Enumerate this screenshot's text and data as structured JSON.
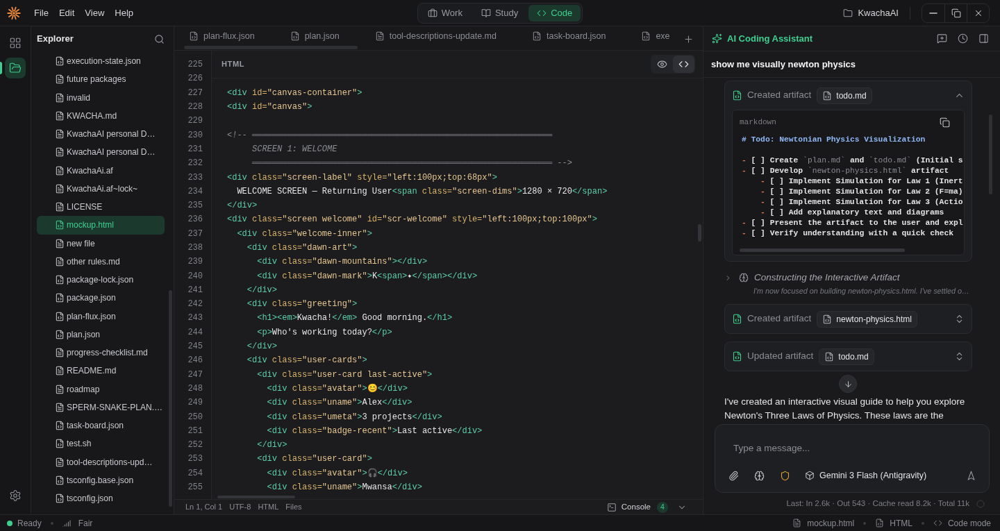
{
  "top_bar": {
    "menu": [
      "File",
      "Edit",
      "View",
      "Help"
    ],
    "modes": [
      {
        "label": "Work",
        "selected": false
      },
      {
        "label": "Study",
        "selected": false
      },
      {
        "label": "Code",
        "selected": true
      }
    ],
    "workspace": "KwachaAI"
  },
  "activity_bar": [
    {
      "selected": false
    },
    {
      "selected": true
    }
  ],
  "explorer": {
    "title": "Explorer",
    "files": [
      {
        "name": "execution-state.json",
        "kind": "code",
        "selected": false
      },
      {
        "name": "future packages",
        "kind": "text",
        "selected": false
      },
      {
        "name": "invalid",
        "kind": "text",
        "selected": false
      },
      {
        "name": "KWACHA.md",
        "kind": "text",
        "selected": false
      },
      {
        "name": "KwachaAI personal D…",
        "kind": "text",
        "selected": false
      },
      {
        "name": "KwachaAI personal D…",
        "kind": "text",
        "selected": false
      },
      {
        "name": "KwachaAi.af",
        "kind": "text",
        "selected": false
      },
      {
        "name": "KwachaAi.af~lock~",
        "kind": "text",
        "selected": false
      },
      {
        "name": "LICENSE",
        "kind": "text",
        "selected": false
      },
      {
        "name": "mockup.html",
        "kind": "code",
        "selected": true
      },
      {
        "name": "new file",
        "kind": "text",
        "selected": false
      },
      {
        "name": "other rules.md",
        "kind": "text",
        "selected": false
      },
      {
        "name": "package-lock.json",
        "kind": "code",
        "selected": false
      },
      {
        "name": "package.json",
        "kind": "code",
        "selected": false
      },
      {
        "name": "plan-flux.json",
        "kind": "code",
        "selected": false
      },
      {
        "name": "plan.json",
        "kind": "code",
        "selected": false
      },
      {
        "name": "progress-checklist.md",
        "kind": "text",
        "selected": false
      },
      {
        "name": "README.md",
        "kind": "text",
        "selected": false
      },
      {
        "name": "roadmap",
        "kind": "text",
        "selected": false
      },
      {
        "name": "SPERM-SNAKE-PLAN.…",
        "kind": "text",
        "selected": false
      },
      {
        "name": "task-board.json",
        "kind": "code",
        "selected": false
      },
      {
        "name": "test.sh",
        "kind": "code",
        "selected": false
      },
      {
        "name": "tool-descriptions-upd…",
        "kind": "text",
        "selected": false
      },
      {
        "name": "tsconfig.base.json",
        "kind": "code",
        "selected": false
      },
      {
        "name": "tsconfig.json",
        "kind": "code",
        "selected": false
      }
    ]
  },
  "editor": {
    "tabs": [
      {
        "label": "plan-flux.json",
        "kind": "code",
        "selected": false
      },
      {
        "label": "plan.json",
        "kind": "code",
        "selected": false
      },
      {
        "label": "tool-descriptions-update.md",
        "kind": "text",
        "selected": false
      },
      {
        "label": "task-board.json",
        "kind": "code",
        "selected": false
      },
      {
        "label": "exe",
        "kind": "code",
        "selected": false
      }
    ],
    "language": "HTML",
    "view_toggle": [
      {
        "selected": false
      },
      {
        "selected": true
      }
    ],
    "lines": [
      {
        "number": "225"
      },
      {
        "number": "226"
      },
      {
        "number": "227",
        "kind": "code",
        "code": "<div id=\"canvas-container\">"
      },
      {
        "number": "228",
        "kind": "code",
        "code": "<div id=\"canvas\">"
      },
      {
        "number": "229"
      },
      {
        "number": "230",
        "kind": "comment",
        "code": "<!-- ════════════════════════════════════════════════════════════"
      },
      {
        "number": "231",
        "kind": "comment",
        "code": "     SCREEN 1: WELCOME"
      },
      {
        "number": "232",
        "kind": "comment",
        "code": "     ════════════════════════════════════════════════════════════ -->"
      },
      {
        "number": "233",
        "kind": "code",
        "code": "<div class=\"screen-label\" style=\"left:100px;top:68px\">"
      },
      {
        "number": "234",
        "kind": "code",
        "code": "  WELCOME SCREEN — Returning User<span class=\"screen-dims\">1280 × 720</span>"
      },
      {
        "number": "235",
        "kind": "code",
        "code": "</div>"
      },
      {
        "number": "236",
        "kind": "code",
        "code": "<div class=\"screen welcome\" id=\"scr-welcome\" style=\"left:100px;top:100px\">"
      },
      {
        "number": "237",
        "kind": "code",
        "code": "  <div class=\"welcome-inner\">"
      },
      {
        "number": "238",
        "kind": "code",
        "code": "    <div class=\"dawn-art\">"
      },
      {
        "number": "239",
        "kind": "code",
        "code": "      <div class=\"dawn-mountains\"></div>"
      },
      {
        "number": "240",
        "kind": "code",
        "code": "      <div class=\"dawn-mark\">K<span>✦</span></div>"
      },
      {
        "number": "241",
        "kind": "code",
        "code": "    </div>"
      },
      {
        "number": "242",
        "kind": "code",
        "code": "    <div class=\"greeting\">"
      },
      {
        "number": "243",
        "kind": "code",
        "code": "      <h1><em>Kwacha!</em> Good morning.</h1>"
      },
      {
        "number": "244",
        "kind": "code",
        "code": "      <p>Who's working today?</p>"
      },
      {
        "number": "245",
        "kind": "code",
        "code": "    </div>"
      },
      {
        "number": "246",
        "kind": "code",
        "code": "    <div class=\"user-cards\">"
      },
      {
        "number": "247",
        "kind": "code",
        "code": "      <div class=\"user-card last-active\">"
      },
      {
        "number": "248",
        "kind": "code",
        "code": "        <div class=\"avatar\">😊</div>"
      },
      {
        "number": "249",
        "kind": "code",
        "code": "        <div class=\"uname\">Alex</div>"
      },
      {
        "number": "250",
        "kind": "code",
        "code": "        <div class=\"umeta\">3 projects</div>"
      },
      {
        "number": "251",
        "kind": "code",
        "code": "        <div class=\"badge-recent\">Last active</div>"
      },
      {
        "number": "252",
        "kind": "code",
        "code": "      </div>"
      },
      {
        "number": "253",
        "kind": "code",
        "code": "      <div class=\"user-card\">"
      },
      {
        "number": "254",
        "kind": "code",
        "code": "        <div class=\"avatar\">🎧</div>"
      },
      {
        "number": "255",
        "kind": "code",
        "code": "        <div class=\"uname\">Mwansa</div>"
      }
    ],
    "status": {
      "items": [
        "Ln 1, Col 1",
        "UTF-8",
        "HTML",
        "Files"
      ],
      "console": {
        "label": "Console",
        "count": "4"
      }
    }
  },
  "assistant": {
    "title": "AI Coding Assistant",
    "prompt": "show me visually newton physics",
    "messages": [
      {
        "kind": "artifact",
        "action": "Created artifact",
        "file": "todo.md",
        "expanded": true,
        "preview": {
          "language": "markdown",
          "heading": "# Todo: Newtonian Physics Visualization",
          "items": [
            {
              "text": "- [ ] Create `plan.md` and `todo.md` (Initial s"
            },
            {
              "text": "- [ ] Develop `newton-physics.html` artifact",
              "children": [
                {
                  "text": "- [ ] Implement Simulation for Law 1 (Inert"
                },
                {
                  "text": "- [ ] Implement Simulation for Law 2 (F=ma)"
                },
                {
                  "text": "- [ ] Implement Simulation for Law 3 (Actio"
                },
                {
                  "text": "- [ ] Add explanatory text and diagrams"
                }
              ]
            },
            {
              "text": "- [ ] Present the artifact to the user and expl"
            },
            {
              "text": "- [ ] Verify understanding with a quick check"
            }
          ]
        }
      },
      {
        "kind": "thinking",
        "title": "Constructing the Interactive Artifact",
        "summary": "I'm now focused on building newton-physics.html. I've settled o…",
        "expanded": false
      },
      {
        "kind": "artifact",
        "action": "Created artifact",
        "file": "newton-physics.html",
        "expanded": false
      },
      {
        "kind": "artifact",
        "action": "Updated artifact",
        "file": "todo.md",
        "expanded": false
      },
      {
        "kind": "text",
        "text": "I've created an interactive visual guide to help you explore Newton's Three Laws of Physics. These laws are the"
      }
    ],
    "composer": {
      "placeholder": "Type a message...",
      "model": "Gemini 3 Flash (Antigravity)"
    },
    "usage": "Last: In 2.6k · Out 543 · Cache read 8.2k · Total 11k"
  },
  "status_bar": {
    "state": "Ready",
    "connection": "Fair",
    "file": "mockup.html",
    "language": "HTML",
    "mode": "Code mode"
  }
}
